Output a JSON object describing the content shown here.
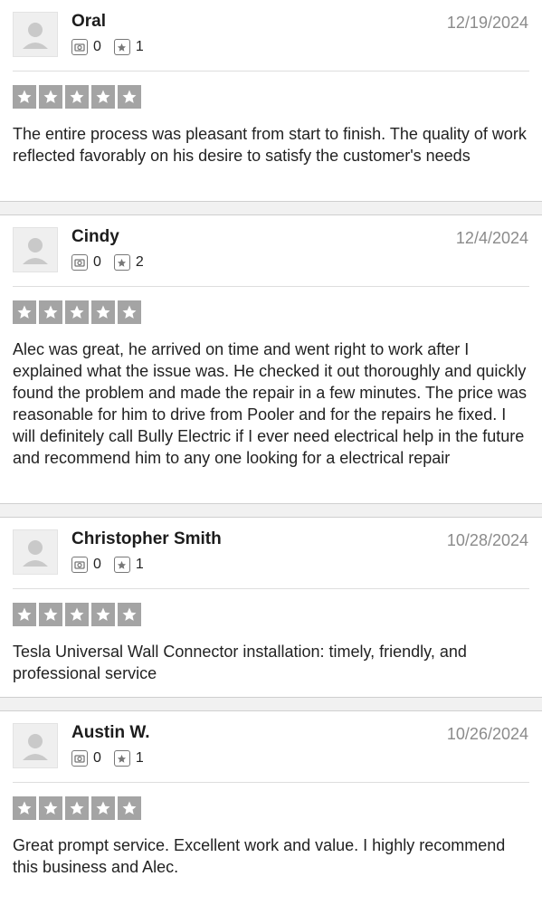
{
  "reviews": [
    {
      "name": "Oral",
      "date": "12/19/2024",
      "photos": "0",
      "reviews": "1",
      "rating": 5,
      "text": "The entire process was pleasant from start to finish. The quality of work reflected favorably on his desire to satisfy the customer's needs"
    },
    {
      "name": "Cindy",
      "date": "12/4/2024",
      "photos": "0",
      "reviews": "2",
      "rating": 5,
      "text": "Alec was great, he arrived on time and went right to work after I explained what the issue was. He checked it out thoroughly and quickly found the problem and made the repair in a few minutes. The price was reasonable for him to drive from Pooler and for the repairs he fixed. I will definitely call Bully Electric if I ever need electrical help in the future and recommend him to any one looking for a electrical repair"
    },
    {
      "name": "Christopher Smith",
      "date": "10/28/2024",
      "photos": "0",
      "reviews": "1",
      "rating": 5,
      "text": "Tesla Universal Wall Connector installation: timely, friendly, and professional service"
    },
    {
      "name": "Austin W.",
      "date": "10/26/2024",
      "photos": "0",
      "reviews": "1",
      "rating": 5,
      "text": "Great prompt service. Excellent work and value. I highly recommend this business and Alec."
    }
  ],
  "icons": {
    "avatar": "default-user-avatar-icon",
    "photos": "camera-icon",
    "reviews": "star-badge-icon",
    "star": "star-icon"
  },
  "colors": {
    "star_fill": "#a4a4a4",
    "date": "#8b8b8b"
  }
}
